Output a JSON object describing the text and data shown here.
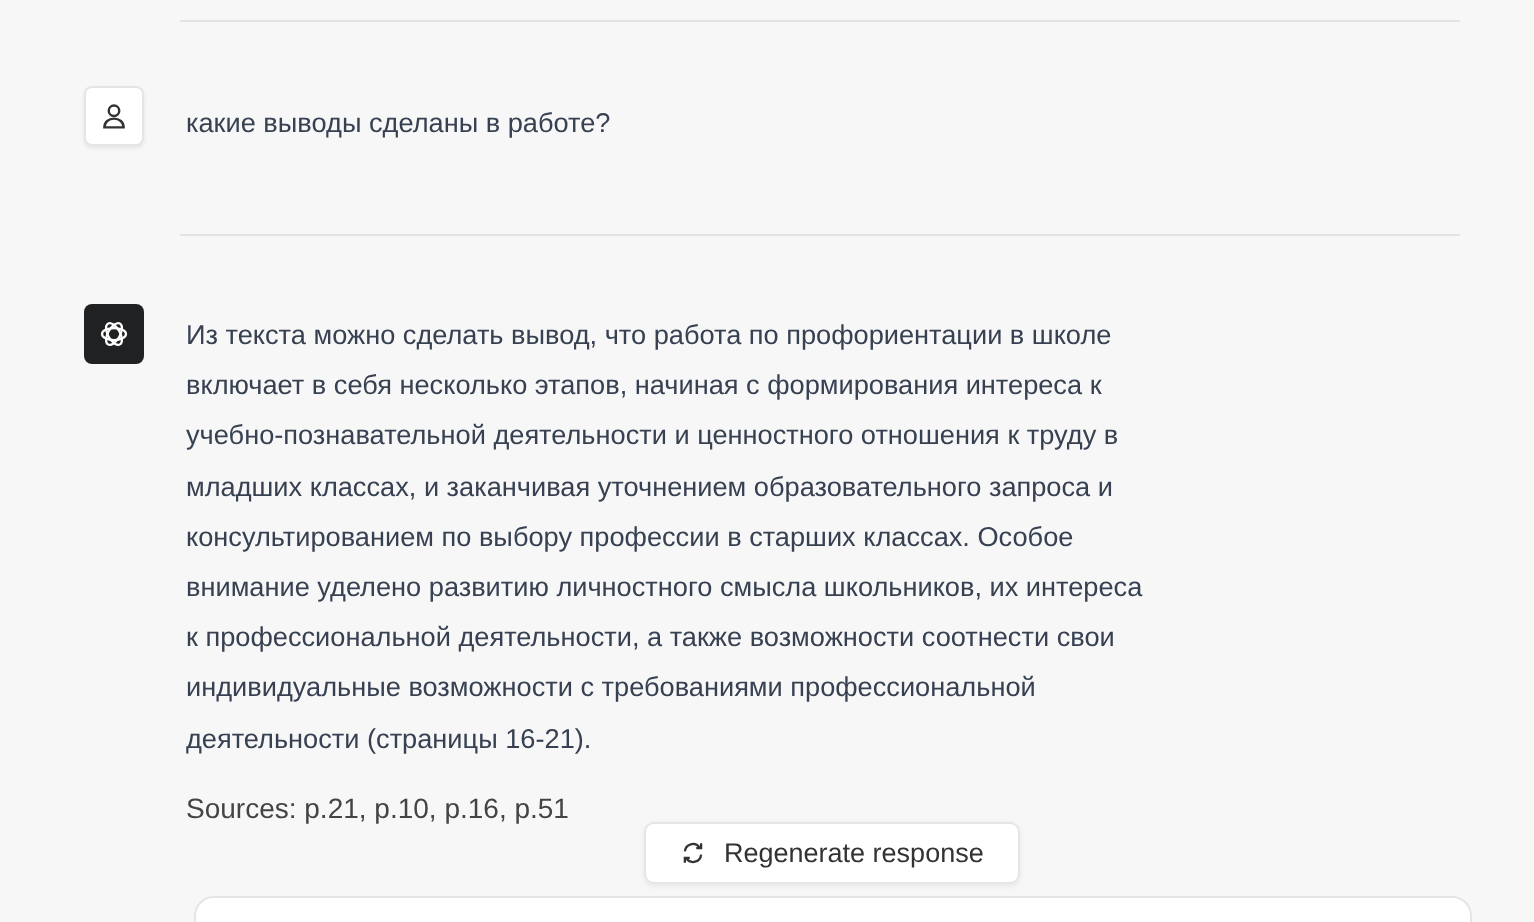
{
  "messages": [
    {
      "kind": "user",
      "text": "какие выводы сделаны в работе?"
    },
    {
      "kind": "assistant",
      "text": "Из текста можно сделать вывод, что работа по профориентации в школе включает в себя несколько этапов, начиная с формирования интереса к учебно-познавательной деятельности и ценностного отношения к труду в младших классах, и заканчивая уточнением образовательного запроса и консультированием по выбору профессии в старших классах. Особое внимание уделено развитию личностного смысла школьников, их интереса к профессиональной деятельности, а также возможности соотнести свои индивидуальные возможности с требованиями профессиональной деятельности (страницы 16-21).",
      "sources": "Sources: p.21, p.10, p.16, p.51"
    }
  ],
  "regenerate_button": {
    "label": "Regenerate response"
  }
}
